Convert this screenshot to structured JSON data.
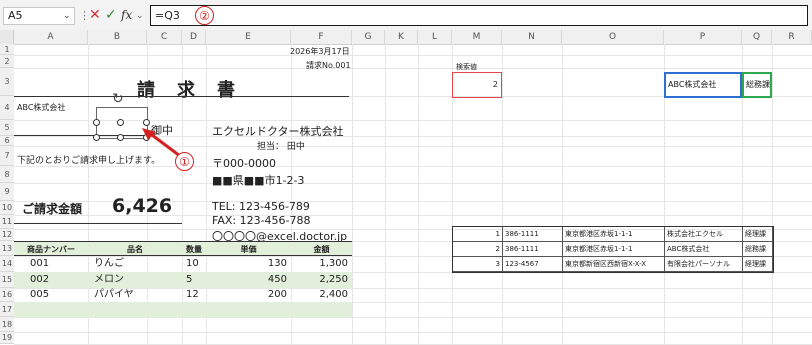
{
  "formula_bar": {
    "name_box": "A5",
    "fx_label": "fx",
    "formula": "=Q3",
    "badge": "②"
  },
  "columns": [
    "A",
    "B",
    "C",
    "D",
    "E",
    "F",
    "G",
    "K",
    "L",
    "M",
    "N",
    "O",
    "P",
    "Q",
    "R"
  ],
  "rows": [
    "1",
    "2",
    "3",
    "4",
    "5",
    "6",
    "7",
    "8",
    "9",
    "10",
    "11",
    "12",
    "13",
    "14",
    "15",
    "16",
    "17",
    "18",
    "19"
  ],
  "invoice": {
    "date": "2026年3月17日",
    "number": "請求No.001",
    "title": "請　求　書",
    "client": "ABC株式会社",
    "honorific": "御中",
    "company": "エクセルドクター株式会社",
    "contact": "担当：  田中",
    "note": "下記のとおりご請求申し上げます。",
    "postal": "〒000-0000",
    "address": "■■県■■市1-2-3",
    "amount_label": "ご請求金額",
    "amount": "6,426",
    "tel": "TEL: 123-456-789",
    "fax": "FAX: 123-456-788",
    "email": "〇〇〇〇@excel.doctor.jp",
    "badge": "①",
    "table_headers": [
      "商品ナンバー",
      "品名",
      "数量",
      "単価",
      "金額"
    ],
    "items": [
      {
        "no": "001",
        "name": "りんご",
        "qty": "10",
        "price": "130",
        "amount": "1,300"
      },
      {
        "no": "002",
        "name": "メロン",
        "qty": "5",
        "price": "450",
        "amount": "2,250"
      },
      {
        "no": "005",
        "name": "パパイヤ",
        "qty": "12",
        "price": "200",
        "amount": "2,400"
      }
    ]
  },
  "lookup": {
    "label": "検索値",
    "value": "2",
    "result_company": "ABC株式会社",
    "result_dept": "総務課"
  },
  "master_table": [
    {
      "id": "1",
      "postal": "386-1111",
      "address": "東京都港区赤坂1-1-1",
      "company": "株式会社エクセル",
      "dept": "経理課"
    },
    {
      "id": "2",
      "postal": "386-1111",
      "address": "東京都港区赤坂1-1-1",
      "company": "ABC株式会社",
      "dept": "総務課"
    },
    {
      "id": "3",
      "postal": "123-4567",
      "address": "東京都新宿区西新宿X-X-X",
      "company": "有限会社パーソナル",
      "dept": "経理課"
    }
  ]
}
